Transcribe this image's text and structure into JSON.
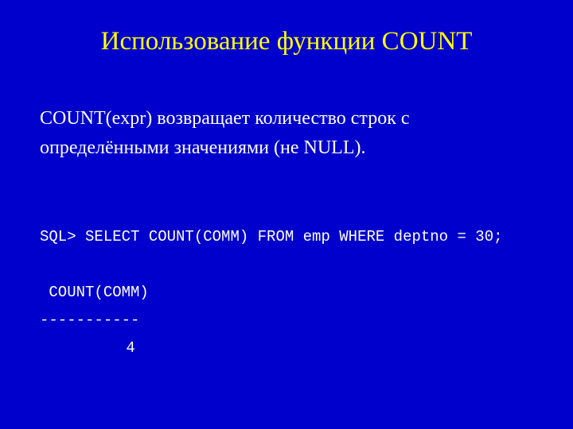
{
  "title": "Использование функции COUNT",
  "body": "COUNT(expr) возвращает количество строк с определёнными значениями (не NULL).",
  "code": {
    "line1": "SQL> SELECT COUNT(COMM) FROM emp WHERE deptno = 30;",
    "blank1": "",
    "line2": " COUNT(COMM)",
    "line3": "-----------",
    "line4_value": "4"
  }
}
